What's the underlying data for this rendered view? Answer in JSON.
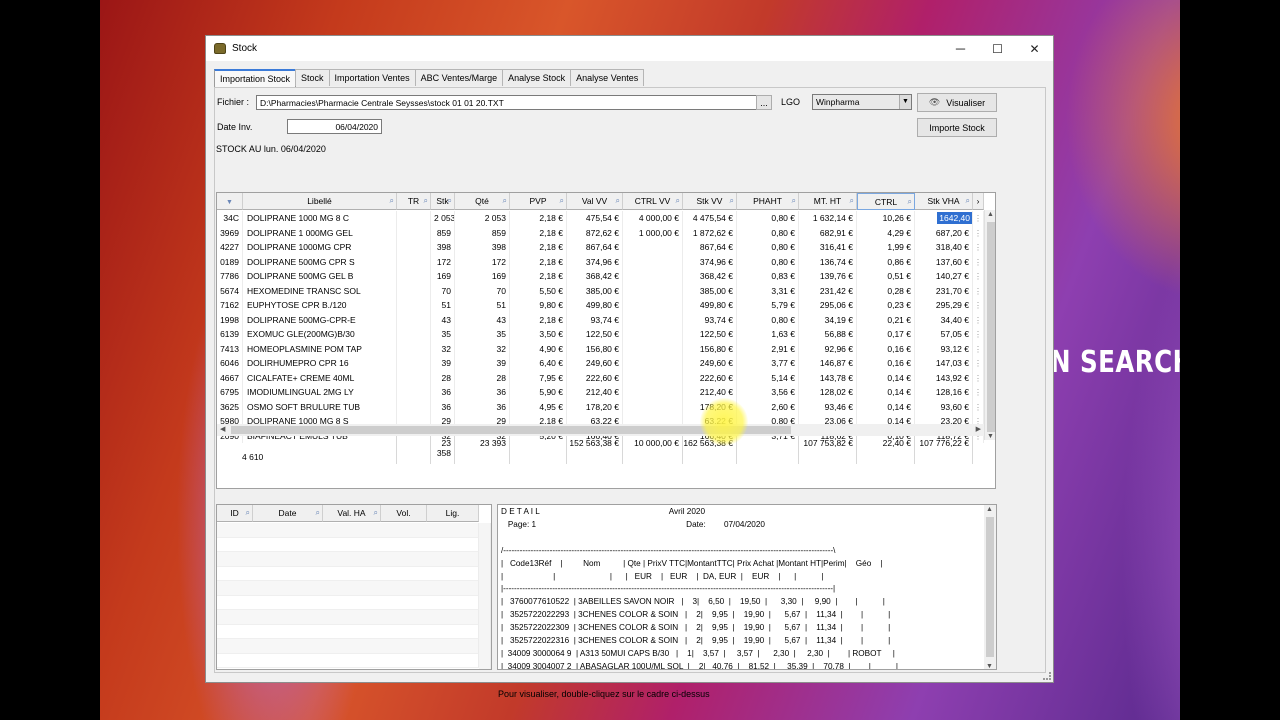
{
  "desktop": {
    "overlay_text": "N SEARCH C"
  },
  "window": {
    "title": "Stock",
    "controls": {
      "minimize": "─",
      "maximize": "☐",
      "close": "✕"
    }
  },
  "tabs": [
    "Importation Stock",
    "Stock",
    "Importation Ventes",
    "ABC Ventes/Marge",
    "Analyse Stock",
    "Analyse Ventes"
  ],
  "form": {
    "fichier_label": "Fichier :",
    "fichier_value": "D:\\Pharmacies\\Pharmacie Centrale Seysses\\stock 01 01 20.TXT",
    "browse": "...",
    "lgo_label": "LGO",
    "lgo_value": "Winpharma",
    "visualiser": "Visualiser",
    "date_label": "Date Inv.",
    "date_value": "06/04/2020",
    "importe": "Importe Stock",
    "stock_au": "STOCK AU lun. 06/04/2020"
  },
  "grid": {
    "columns": [
      "Libellé",
      "TR",
      "Stk",
      "Qté",
      "PVP",
      "Val VV",
      "CTRL VV",
      "Stk VV",
      "PHAHT",
      "MT. HT",
      "CTRL",
      "Stk VHA"
    ],
    "rows": [
      [
        "34C",
        "DOLIPRANE 1000 MG 8 C",
        "",
        "2 053",
        "2 053",
        "2,18 €",
        "475,54 €",
        "4 000,00 €",
        "4 475,54 €",
        "0,80 €",
        "1 632,14 €",
        "10,26 €",
        "1642,40"
      ],
      [
        "3969",
        "DOLIPRANE 1 000MG GEL",
        "",
        "859",
        "859",
        "2,18 €",
        "872,62 €",
        "1 000,00 €",
        "1 872,62 €",
        "0,80 €",
        "682,91 €",
        "4,29 €",
        "687,20 €"
      ],
      [
        "4227",
        "DOLIPRANE 1000MG CPR",
        "",
        "398",
        "398",
        "2,18 €",
        "867,64 €",
        "",
        "867,64 €",
        "0,80 €",
        "316,41 €",
        "1,99 €",
        "318,40 €"
      ],
      [
        "0189",
        "DOLIPRANE 500MG CPR S",
        "",
        "172",
        "172",
        "2,18 €",
        "374,96 €",
        "",
        "374,96 €",
        "0,80 €",
        "136,74 €",
        "0,86 €",
        "137,60 €"
      ],
      [
        "7786",
        "DOLIPRANE 500MG GEL B",
        "",
        "169",
        "169",
        "2,18 €",
        "368,42 €",
        "",
        "368,42 €",
        "0,83 €",
        "139,76 €",
        "0,51 €",
        "140,27 €"
      ],
      [
        "5674",
        "HEXOMEDINE TRANSC SOL",
        "",
        "70",
        "70",
        "5,50 €",
        "385,00 €",
        "",
        "385,00 €",
        "3,31 €",
        "231,42 €",
        "0,28 €",
        "231,70 €"
      ],
      [
        "7162",
        "EUPHYTOSE CPR B./120",
        "",
        "51",
        "51",
        "9,80 €",
        "499,80 €",
        "",
        "499,80 €",
        "5,79 €",
        "295,06 €",
        "0,23 €",
        "295,29 €"
      ],
      [
        "1998",
        "DOLIPRANE 500MG-CPR-E",
        "",
        "43",
        "43",
        "2,18 €",
        "93,74 €",
        "",
        "93,74 €",
        "0,80 €",
        "34,19 €",
        "0,21 €",
        "34,40 €"
      ],
      [
        "6139",
        "EXOMUC GLE(200MG)B/30",
        "",
        "35",
        "35",
        "3,50 €",
        "122,50 €",
        "",
        "122,50 €",
        "1,63 €",
        "56,88 €",
        "0,17 €",
        "57,05 €"
      ],
      [
        "7413",
        "HOMEOPLASMINE POM TAP",
        "",
        "32",
        "32",
        "4,90 €",
        "156,80 €",
        "",
        "156,80 €",
        "2,91 €",
        "92,96 €",
        "0,16 €",
        "93,12 €"
      ],
      [
        "6046",
        "DOLIRHUMEPRO CPR 16",
        "",
        "39",
        "39",
        "6,40 €",
        "249,60 €",
        "",
        "249,60 €",
        "3,77 €",
        "146,87 €",
        "0,16 €",
        "147,03 €"
      ],
      [
        "4667",
        "CICALFATE+ CREME 40ML",
        "",
        "28",
        "28",
        "7,95 €",
        "222,60 €",
        "",
        "222,60 €",
        "5,14 €",
        "143,78 €",
        "0,14 €",
        "143,92 €"
      ],
      [
        "6795",
        "IMODIUMLINGUAL 2MG LY",
        "",
        "36",
        "36",
        "5,90 €",
        "212,40 €",
        "",
        "212,40 €",
        "3,56 €",
        "128,02 €",
        "0,14 €",
        "128,16 €"
      ],
      [
        "3625",
        "OSMO SOFT BRULURE TUB",
        "",
        "36",
        "36",
        "4,95 €",
        "178,20 €",
        "",
        "178,20 €",
        "2,60 €",
        "93,46 €",
        "0,14 €",
        "93,60 €"
      ],
      [
        "5980",
        "DOLIPRANE 1000 MG 8 S",
        "",
        "29",
        "29",
        "2,18 €",
        "63,22 €",
        "",
        "63,22 €",
        "0,80 €",
        "23,06 €",
        "0,14 €",
        "23,20 €"
      ],
      [
        "2090",
        "BIAFINEACT EMULS TUB",
        "",
        "32",
        "32",
        "5,20 €",
        "166,40 €",
        "",
        "166,40 €",
        "3,71 €",
        "118,62 €",
        "0,10 €",
        "118,72 €"
      ]
    ],
    "totals": {
      "count": "4 610",
      "stk": "23 358",
      "qte": "23 393",
      "valvv": "152 563,38 €",
      "ctrlvv": "10 000,00 €",
      "stkvv": "162 563,38 €",
      "mtht": "107 753,82 €",
      "ctrl": "22,40 €",
      "stkvha": "107 776,22 €"
    }
  },
  "bottom_grid": {
    "columns": [
      "ID",
      "Date",
      "Val. HA",
      "Vol.",
      "Lig."
    ]
  },
  "detail": {
    "lines": [
      "D E T A I L                                                         Avril 2020",
      "   Page: 1                                                                  Date:        07/04/2020",
      "",
      "/-------------------------------------------------------------------------------------------------------------------------\\",
      "|   Code13Réf    |         Nom          | Qte | PrixV TTC|MontantTTC| Prix Achat |Montant HT|Perim|    Géo    |",
      "|                      |                        |      |   EUR    |   EUR    |  DA, EUR  |    EUR    |      |           |",
      "|-------------------------------------------------------------------------------------------------------------------------|",
      "|   3760077610522  | 3ABEILLES SAVON NOIR   |    3|    6,50  |    19,50  |      3,30  |     9,90  |        |           |",
      "|   3525722022293  | 3CHENES COLOR & SOIN   |    2|    9,95  |    19,90  |      5,67  |    11,34  |        |           |",
      "|   3525722022309  | 3CHENES COLOR & SOIN   |    2|    9,95  |    19,90  |      5,67  |    11,34  |        |           |",
      "|   3525722022316  | 3CHENES COLOR & SOIN   |    2|    9,95  |    19,90  |      5,67  |    11,34  |        |           |",
      "|  34009 3000064 9  | A313 50MUI CAPS B/30   |    1|    3,57  |     3,57  |      2,30  |     2,30  |        | ROBOT     |",
      "|  34009 3004007 2  | ABASAGLAR 100U/ML SOL  |    2|   40,76  |    81,52  |     35,39  |    70,78  |        |           |"
    ]
  },
  "hint": "Pour visualiser, double-cliquez sur le cadre ci-dessus"
}
